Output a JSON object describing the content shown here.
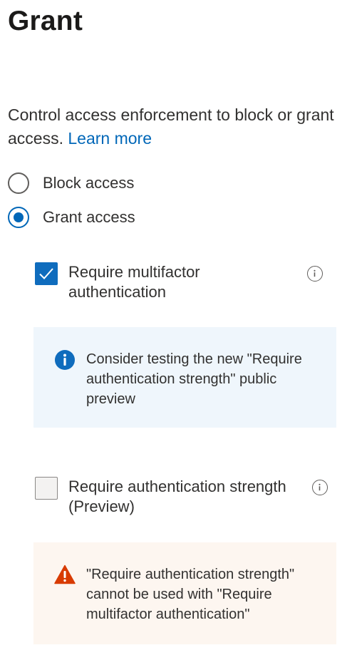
{
  "header": {
    "title": "Grant"
  },
  "description": {
    "text": "Control access enforcement to block or grant access.",
    "link": "Learn more"
  },
  "access_options": [
    {
      "label": "Block access",
      "selected": false
    },
    {
      "label": "Grant access",
      "selected": true
    }
  ],
  "controls": {
    "require_mfa": {
      "label": "Require multifactor authentication",
      "checked": true,
      "info_icon": "info-icon"
    },
    "mfa_banner": {
      "icon": "info-filled-icon",
      "text": "Consider testing the new \"Require authentication strength\" public preview"
    },
    "require_auth_strength": {
      "label": "Require authentication strength (Preview)",
      "checked": false,
      "info_icon": "info-icon"
    },
    "strength_banner": {
      "icon": "warning-icon",
      "text": "\"Require authentication strength\" cannot be used with \"Require multifactor authentication\""
    }
  },
  "colors": {
    "accent": "#0067b8",
    "info_banner_bg": "#eff6fc",
    "warning_banner_bg": "#fdf6f0",
    "warning_icon": "#d83b01"
  }
}
